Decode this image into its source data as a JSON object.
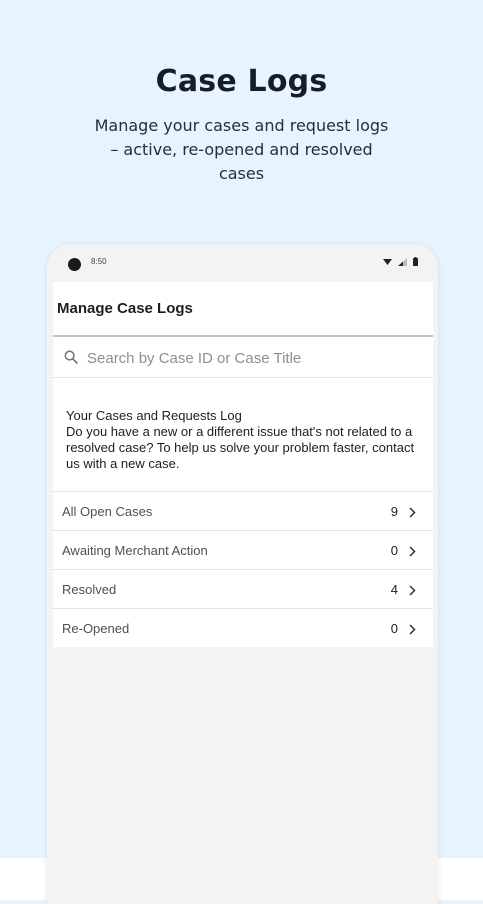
{
  "promo": {
    "title": "Case Logs",
    "subtitle": "Manage your cases and request logs – active, re-opened and resolved cases"
  },
  "statusbar": {
    "time": "8:50",
    "icons": [
      "wifi-icon",
      "signal-icon",
      "battery-icon"
    ]
  },
  "appbar": {
    "title": "Manage Case Logs"
  },
  "search": {
    "placeholder": "Search by Case ID or Case Title",
    "value": ""
  },
  "info": {
    "title": "Your Cases and Requests Log",
    "text": "Do you have a new or a different issue that's not related to a resolved case? To help us solve your problem faster, contact us with a new case."
  },
  "case_list": [
    {
      "label": "All Open Cases",
      "count": "9"
    },
    {
      "label": "Awaiting Merchant Action",
      "count": "0"
    },
    {
      "label": "Resolved",
      "count": "4"
    },
    {
      "label": "Re-Opened",
      "count": "0"
    }
  ],
  "colors": {
    "background": "#e8f4fd",
    "title_text": "#141d28",
    "screen_bg": "#f3f4f5",
    "divider": "#e1e4e6"
  }
}
